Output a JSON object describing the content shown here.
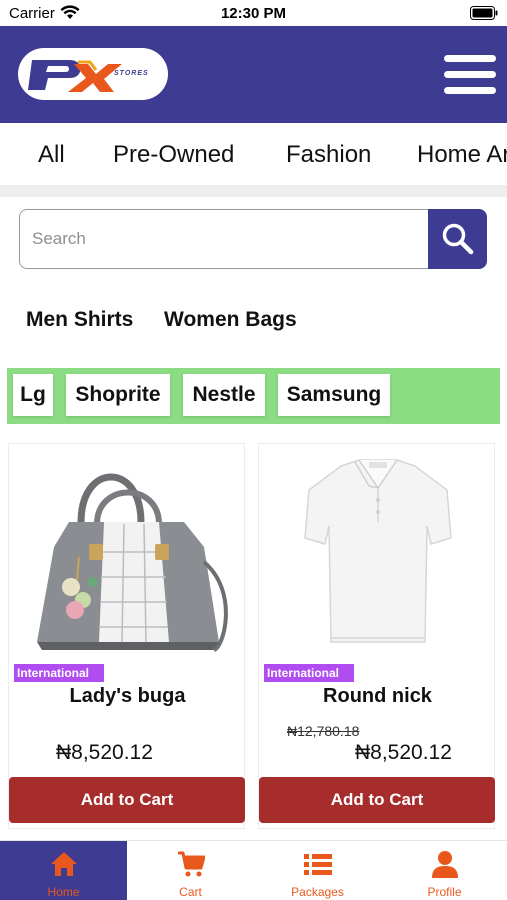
{
  "status_bar": {
    "carrier": "Carrier",
    "time": "12:30 PM"
  },
  "header": {
    "logo_letters": "P",
    "logo_x": "X",
    "logo_sub": "STORES"
  },
  "colors": {
    "brand": "#3d3c92",
    "accent": "#e8581c",
    "cart_button": "#a72c2c",
    "brand_strip": "#8cdc84",
    "badge": "#b04cf0"
  },
  "tabs": [
    {
      "label": "All"
    },
    {
      "label": "Pre-Owned"
    },
    {
      "label": "Fashion"
    },
    {
      "label": "Home Ar"
    }
  ],
  "search": {
    "placeholder": "Search"
  },
  "quick_links": [
    {
      "label": "Men Shirts"
    },
    {
      "label": "Women Bags"
    }
  ],
  "brands": [
    {
      "label": "Lg"
    },
    {
      "label": "Shoprite"
    },
    {
      "label": "Nestle"
    },
    {
      "label": "Samsung"
    }
  ],
  "products": [
    {
      "badge": "International",
      "name": "Lady's buga",
      "old_price": "",
      "price": "₦8,520.12",
      "button": "Add to Cart",
      "image_icon": "handbag-image"
    },
    {
      "badge": "International",
      "name": "Round nick",
      "old_price": "₦12,780.18",
      "price": "₦8,520.12",
      "button": "Add to Cart",
      "image_icon": "polo-shirt-image"
    }
  ],
  "bottom_nav": [
    {
      "label": "Home",
      "icon": "home-icon",
      "active": true
    },
    {
      "label": "Cart",
      "icon": "cart-icon",
      "active": false
    },
    {
      "label": "Packages",
      "icon": "list-icon",
      "active": false
    },
    {
      "label": "Profile",
      "icon": "user-icon",
      "active": false
    }
  ]
}
